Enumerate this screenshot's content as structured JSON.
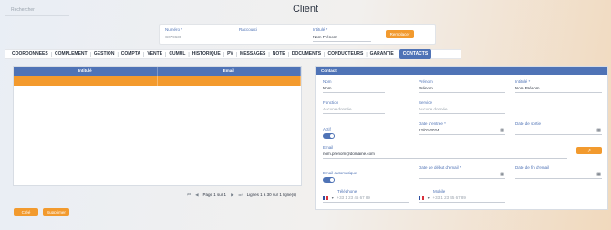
{
  "search": {
    "placeholder": "Rechercher"
  },
  "page": {
    "title": "Client"
  },
  "header": {
    "numero_label": "Numéro *",
    "numero_value": "C079630",
    "raccourci_label": "Raccourci",
    "raccourci_value": "",
    "intitule_label": "Intitulé *",
    "intitule_value": "Nom Prénom",
    "replace_button": "Remplacer"
  },
  "tabs": [
    "COORDONNEES",
    "COMPLEMENT",
    "GESTION",
    "COMPTA",
    "VENTE",
    "CUMUL",
    "HISTORIQUE",
    "PV",
    "MESSAGES",
    "NOTE",
    "DOCUMENTS",
    "CONDUCTEURS",
    "GARANTIE",
    "CONTACTS"
  ],
  "active_tab": "CONTACTS",
  "grid": {
    "columns": [
      "Intitulé",
      "Email"
    ],
    "rows": [
      [
        "",
        ""
      ]
    ]
  },
  "pager": {
    "first": "⏮",
    "prev": "◀",
    "page": "Page 1 sur 1",
    "next": "▶",
    "last": "⏭",
    "range": "Lignes 1 à 30 sur 1 ligne(s)"
  },
  "buttons": {
    "create": "Créé",
    "delete": "Supprimer"
  },
  "contact": {
    "title": "Contact",
    "nom_label": "Nom",
    "nom_value": "Nom",
    "prenom_label": "Prénom",
    "prenom_value": "Prénom",
    "intitule_label": "Intitulé *",
    "intitule_value": "Nom Prénom",
    "fonction_label": "Fonction",
    "fonction_value": "Aucune donnée",
    "service_label": "Service",
    "service_value": "Aucune donnée",
    "actif_label": "Actif",
    "actif_on": true,
    "date_entree_label": "Date d'entrée *",
    "date_entree_value": "12/01/2024",
    "date_sortie_label": "Date de sortie",
    "date_sortie_value": "",
    "email_label": "Email",
    "email_value": "nom.prenom@domaine.com",
    "email_button": "↗",
    "email_auto_label": "Email automatique",
    "email_auto_on": true,
    "date_debut_label": "Date de début d'email *",
    "date_debut_value": "",
    "date_fin_label": "Date de fin d'email",
    "date_fin_value": "",
    "telephone_label": "Téléphone",
    "telephone_value": "+33 1 23 45 67 89",
    "mobile_label": "Mobile",
    "mobile_value": "+33 1 23 45 67 89"
  },
  "colors": {
    "accent_blue": "#4f73b6",
    "accent_orange": "#f29a2e"
  }
}
